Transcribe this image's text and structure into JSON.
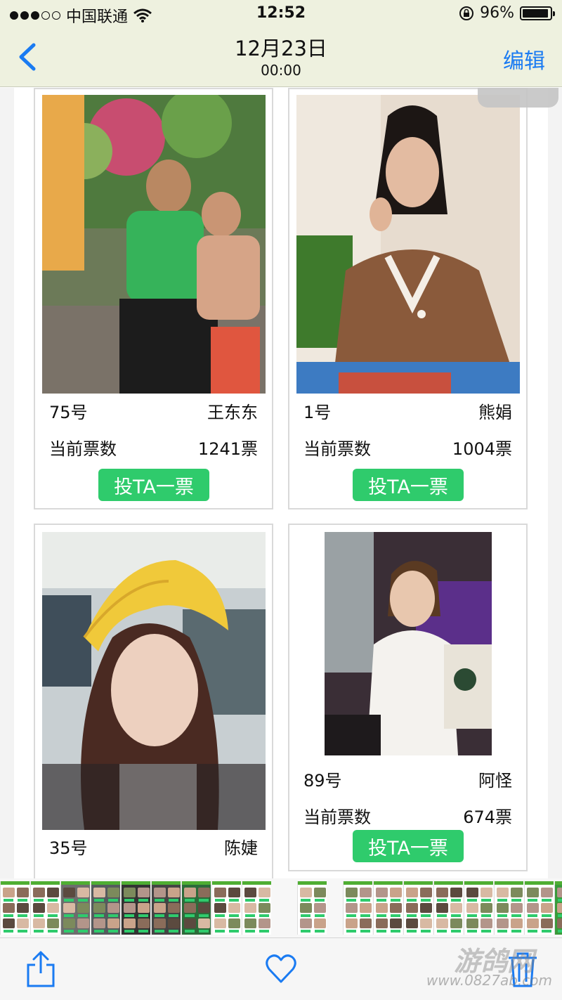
{
  "status_bar": {
    "carrier": "中国联通",
    "time": "12:52",
    "battery_text": "96%",
    "battery_level": 0.96,
    "signal_bars": 3,
    "signal_total": 5
  },
  "nav": {
    "title": "12月23日",
    "subtitle": "00:00",
    "edit_label": "编辑",
    "back_icon": "chevron-left-icon"
  },
  "cards": [
    {
      "number": "75号",
      "name": "王东东",
      "votes_label": "当前票数",
      "votes": "1241票",
      "button": "投TA一票"
    },
    {
      "number": "1号",
      "name": "熊娟",
      "votes_label": "当前票数",
      "votes": "1004票",
      "button": "投TA一票"
    },
    {
      "number": "35号",
      "name": "陈婕"
    },
    {
      "number": "89号",
      "name": "阿怪",
      "votes_label": "当前票数",
      "votes": "674票",
      "button": "投TA一票"
    }
  ],
  "toolbar": {
    "share_icon": "share-icon",
    "favorite_icon": "heart-icon",
    "delete_icon": "trash-icon"
  },
  "watermark": {
    "logo_text": "游鸽网",
    "url": "www.0827ab.com"
  },
  "colors": {
    "bar_bg": "#eef1df",
    "accent_blue": "#1a7bf2",
    "vote_green": "#2fcb6c"
  }
}
